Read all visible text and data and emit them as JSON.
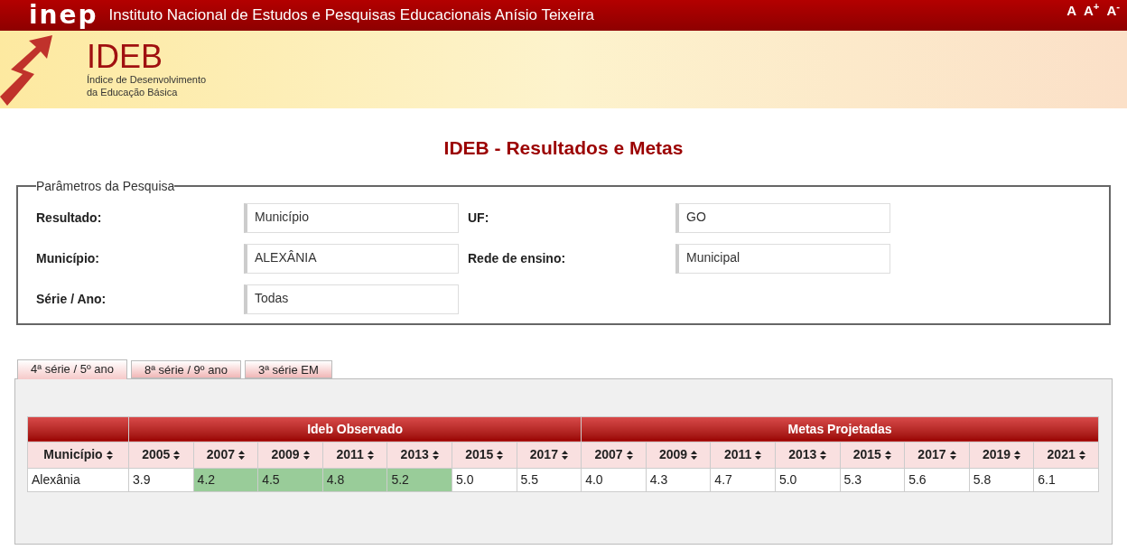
{
  "header": {
    "logo": "inep",
    "title": "Instituto Nacional de Estudos e Pesquisas Educacionais Anísio Teixeira",
    "font_buttons": [
      "A",
      "A$^{+}$",
      "A$^{-}$"
    ]
  },
  "banner": {
    "title": "IDEB",
    "subtitle_lines": [
      "Índice de Desenvolvimento",
      "da Educação Básica"
    ]
  },
  "page_title": "IDEB - Resultados e Metas",
  "params": {
    "legend": "Parâmetros da Pesquisa",
    "fields": [
      {
        "label": "Resultado:",
        "value": "Município"
      },
      {
        "label": "UF:",
        "value": "GO"
      },
      {
        "label": "Município:",
        "value": "ALEXÂNIA"
      },
      {
        "label": "Rede de ensino:",
        "value": "Municipal"
      },
      {
        "label": "Série / Ano:",
        "value": "Todas"
      }
    ]
  },
  "tabs": [
    {
      "label": "4ª série / 5º ano",
      "selected": true
    },
    {
      "label": "8ª série / 9º ano",
      "selected": false
    },
    {
      "label": "3ª série EM",
      "selected": false
    }
  ],
  "table": {
    "first_column": "Município",
    "groups": [
      {
        "label": "Ideb Observado",
        "columns": [
          "2005",
          "2007",
          "2009",
          "2011",
          "2013",
          "2015",
          "2017"
        ]
      },
      {
        "label": "Metas Projetadas",
        "columns": [
          "2007",
          "2009",
          "2011",
          "2013",
          "2015",
          "2017",
          "2019",
          "2021"
        ]
      }
    ],
    "rows": [
      {
        "cells": [
          {
            "text": "Alexânia",
            "highlighted": false
          },
          {
            "text": "3.9",
            "highlighted": false
          },
          {
            "text": "4.2",
            "highlighted": true
          },
          {
            "text": "4.5",
            "highlighted": true
          },
          {
            "text": "4.8",
            "highlighted": true
          },
          {
            "text": "5.2",
            "highlighted": true
          },
          {
            "text": "5.0",
            "highlighted": false
          },
          {
            "text": "5.5",
            "highlighted": false
          },
          {
            "text": "4.0",
            "highlighted": false
          },
          {
            "text": "4.3",
            "highlighted": false
          },
          {
            "text": "4.7",
            "highlighted": false
          },
          {
            "text": "5.0",
            "highlighted": false
          },
          {
            "text": "5.3",
            "highlighted": false
          },
          {
            "text": "5.6",
            "highlighted": false
          },
          {
            "text": "5.8",
            "highlighted": false
          },
          {
            "text": "6.1",
            "highlighted": false
          }
        ]
      }
    ]
  }
}
